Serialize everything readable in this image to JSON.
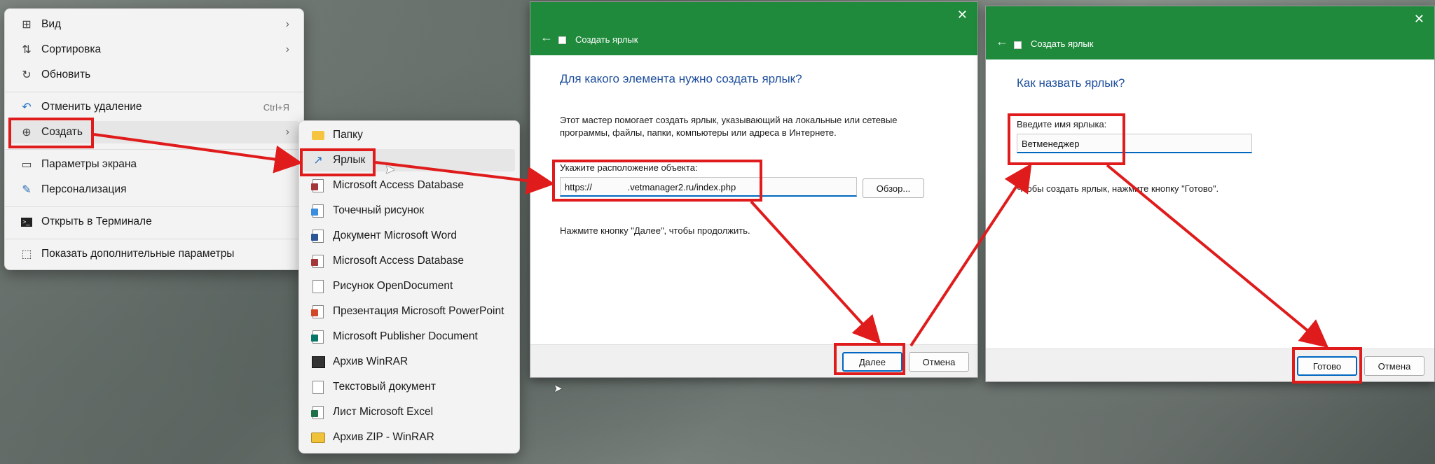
{
  "context_menu": {
    "items": [
      {
        "label": "Вид",
        "icon": "grid-icon",
        "chevron": "›"
      },
      {
        "label": "Сортировка",
        "icon": "sort-icon",
        "chevron": "›"
      },
      {
        "label": "Обновить",
        "icon": "refresh-icon"
      },
      {
        "label": "Отменить удаление",
        "icon": "undo-icon",
        "shortcut": "Ctrl+Я"
      },
      {
        "label": "Создать",
        "icon": "plus-circle-icon",
        "chevron": "›"
      },
      {
        "label": "Параметры экрана",
        "icon": "display-icon"
      },
      {
        "label": "Персонализация",
        "icon": "brush-icon"
      },
      {
        "label": "Открыть в Терминале",
        "icon": "terminal-icon"
      },
      {
        "label": "Показать дополнительные параметры",
        "icon": "more-icon"
      }
    ]
  },
  "submenu": {
    "items": [
      {
        "label": "Папку",
        "icon": "folder-icon"
      },
      {
        "label": "Ярлык",
        "icon": "shortcut-arrow-icon"
      },
      {
        "label": "Microsoft Access Database",
        "icon": "access-icon"
      },
      {
        "label": "Точечный рисунок",
        "icon": "bitmap-icon"
      },
      {
        "label": "Документ Microsoft Word",
        "icon": "word-icon"
      },
      {
        "label": "Microsoft Access Database",
        "icon": "access-icon"
      },
      {
        "label": "Рисунок OpenDocument",
        "icon": "odg-icon"
      },
      {
        "label": "Презентация Microsoft PowerPoint",
        "icon": "powerpoint-icon"
      },
      {
        "label": "Microsoft Publisher Document",
        "icon": "publisher-icon"
      },
      {
        "label": "Архив WinRAR",
        "icon": "winrar-icon"
      },
      {
        "label": "Текстовый документ",
        "icon": "text-file-icon"
      },
      {
        "label": "Лист Microsoft Excel",
        "icon": "excel-icon"
      },
      {
        "label": "Архив ZIP - WinRAR",
        "icon": "zip-icon"
      }
    ]
  },
  "dialog1": {
    "title": "Создать ярлык",
    "heading": "Для какого элемента нужно создать ярлык?",
    "description": "Этот мастер помогает создать ярлык, указывающий на локальные или сетевые программы, файлы, папки, компьютеры или адреса в Интернете.",
    "field_label": "Укажите расположение объекта:",
    "field_value": "https://              .vetmanager2.ru/index.php",
    "browse_label": "Обзор...",
    "hint": "Нажмите кнопку \"Далее\", чтобы продолжить.",
    "next_label": "Далее",
    "cancel_label": "Отмена"
  },
  "dialog2": {
    "title": "Создать ярлык",
    "heading": "Как назвать ярлык?",
    "field_label": "Введите имя ярлыка:",
    "field_value": "Ветменеджер",
    "hint": "Чтобы создать ярлык, нажмите кнопку \"Готово\".",
    "finish_label": "Готово",
    "cancel_label": "Отмена"
  },
  "colors": {
    "annotation_red": "#e01b1b",
    "title_green": "#1f8a3c",
    "heading_blue": "#1e4e9c",
    "accent_blue": "#0067c0"
  }
}
